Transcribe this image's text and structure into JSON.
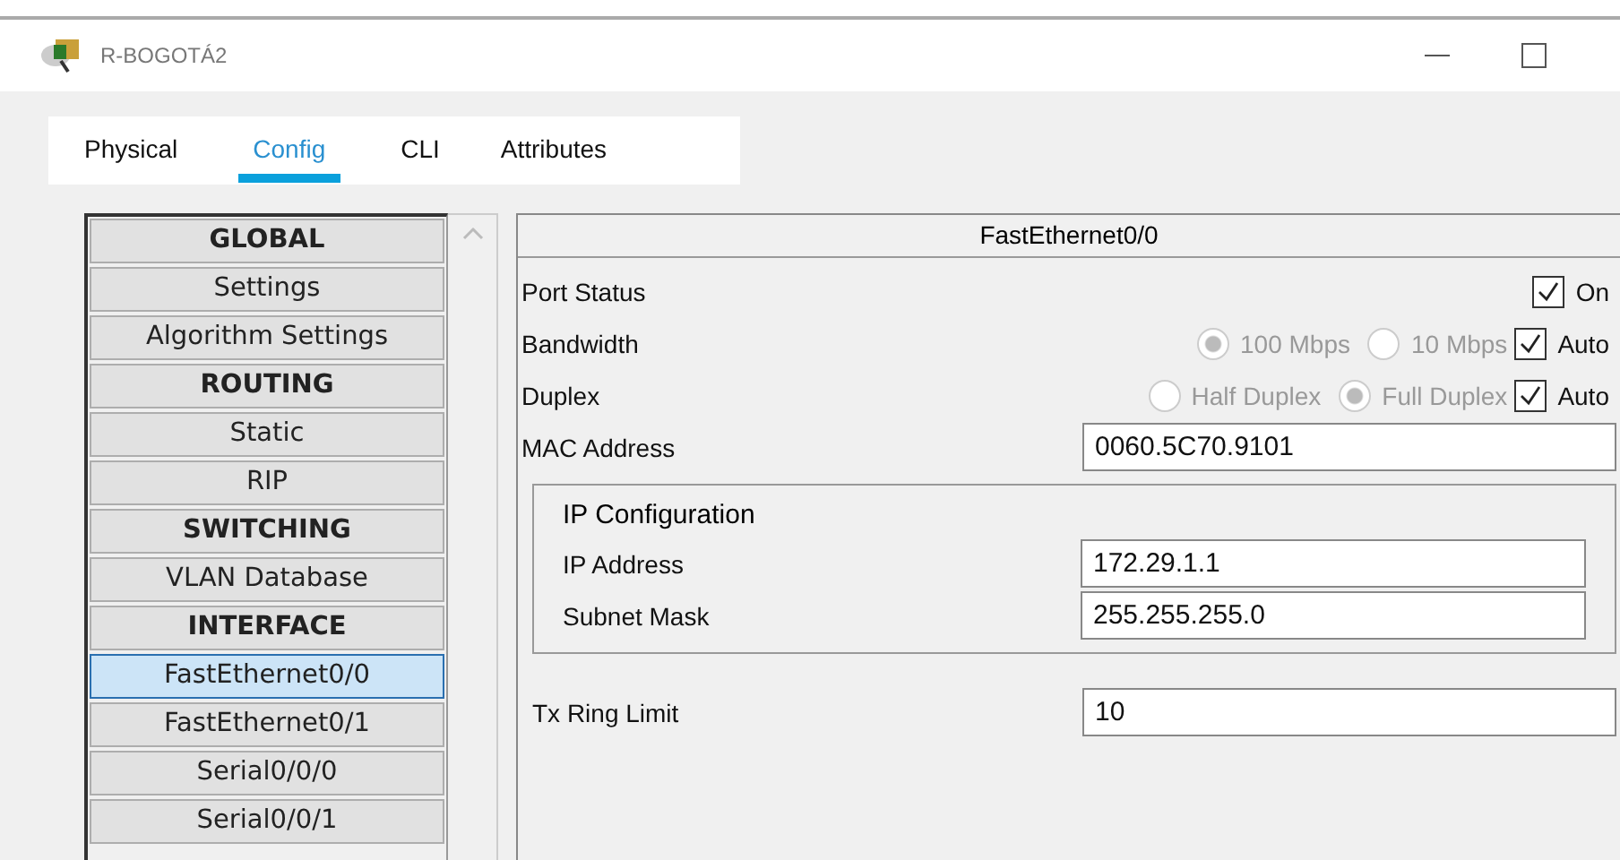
{
  "window": {
    "title": "R-BOGOTÁ2"
  },
  "tabs": [
    {
      "label": "Physical",
      "selected": false
    },
    {
      "label": "Config",
      "selected": true
    },
    {
      "label": "CLI",
      "selected": false
    },
    {
      "label": "Attributes",
      "selected": false
    }
  ],
  "sidebar": {
    "items": [
      {
        "kind": "header",
        "label": "GLOBAL",
        "selected": false
      },
      {
        "kind": "item",
        "label": "Settings",
        "selected": false
      },
      {
        "kind": "item",
        "label": "Algorithm Settings",
        "selected": false
      },
      {
        "kind": "header",
        "label": "ROUTING",
        "selected": false
      },
      {
        "kind": "item",
        "label": "Static",
        "selected": false
      },
      {
        "kind": "item",
        "label": "RIP",
        "selected": false
      },
      {
        "kind": "header",
        "label": "SWITCHING",
        "selected": false
      },
      {
        "kind": "item",
        "label": "VLAN Database",
        "selected": false
      },
      {
        "kind": "header",
        "label": "INTERFACE",
        "selected": false
      },
      {
        "kind": "item",
        "label": "FastEthernet0/0",
        "selected": true
      },
      {
        "kind": "item",
        "label": "FastEthernet0/1",
        "selected": false
      },
      {
        "kind": "item",
        "label": "Serial0/0/0",
        "selected": false
      },
      {
        "kind": "item",
        "label": "Serial0/0/1",
        "selected": false
      }
    ]
  },
  "panel": {
    "title": "FastEthernet0/0",
    "port_status": {
      "label": "Port Status",
      "checkbox": {
        "label": "On",
        "checked": true
      }
    },
    "bandwidth": {
      "label": "Bandwidth",
      "options": [
        {
          "label": "100 Mbps",
          "selected": true,
          "disabled": true
        },
        {
          "label": "10 Mbps",
          "selected": false,
          "disabled": true
        }
      ],
      "auto": {
        "label": "Auto",
        "checked": true
      }
    },
    "duplex": {
      "label": "Duplex",
      "options": [
        {
          "label": "Half Duplex",
          "selected": false,
          "disabled": true
        },
        {
          "label": "Full Duplex",
          "selected": true,
          "disabled": true
        }
      ],
      "auto": {
        "label": "Auto",
        "checked": true
      }
    },
    "mac_address": {
      "label": "MAC Address",
      "value": "0060.5C70.9101"
    },
    "ip_configuration": {
      "title": "IP Configuration",
      "ip_address": {
        "label": "IP Address",
        "value": "172.29.1.1"
      },
      "subnet_mask": {
        "label": "Subnet Mask",
        "value": "255.255.255.0"
      }
    },
    "tx_ring_limit": {
      "label": "Tx Ring Limit",
      "value": "10"
    }
  }
}
